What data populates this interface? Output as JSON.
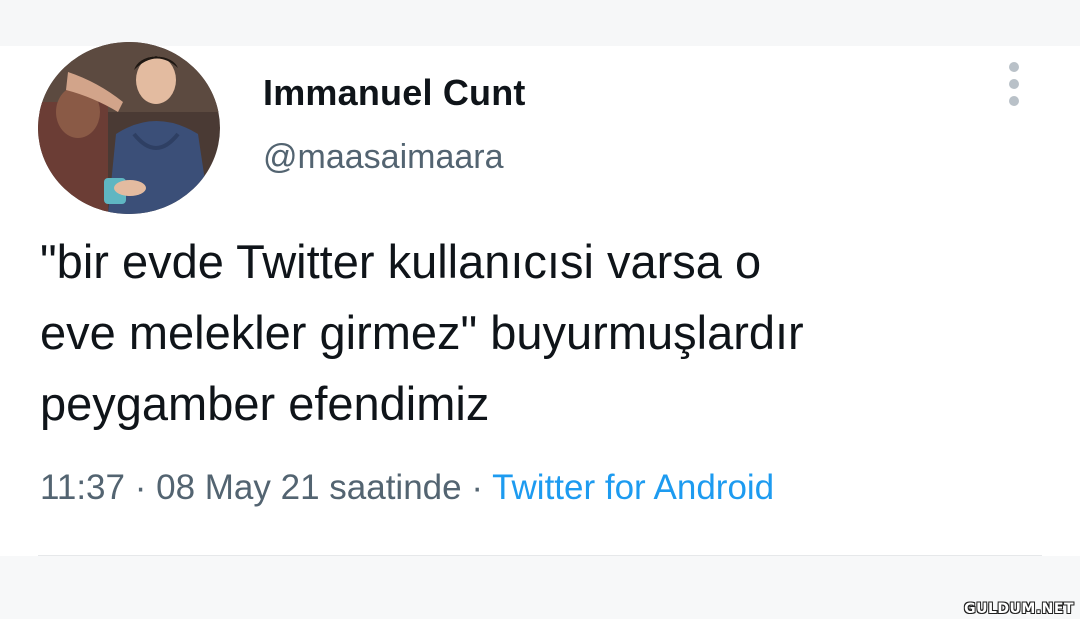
{
  "tweet": {
    "display_name": "Immanuel Cunt",
    "handle": "@maasaimaara",
    "text_lines": [
      "\"bir evde Twitter kullanıcısi varsa o",
      "eve melekler girmez\" buyurmuşlardır",
      "peygamber efendimiz"
    ],
    "time": "11:37",
    "separator": " · ",
    "date": "08 May 21 saatinde",
    "source": "Twitter for Android"
  },
  "icons": {
    "more": "more-vertical-icon",
    "avatar": "profile-photo"
  },
  "colors": {
    "text": "#0f1419",
    "secondary": "#536471",
    "link": "#1d9bf0"
  },
  "watermark": "GULDUM.NET"
}
